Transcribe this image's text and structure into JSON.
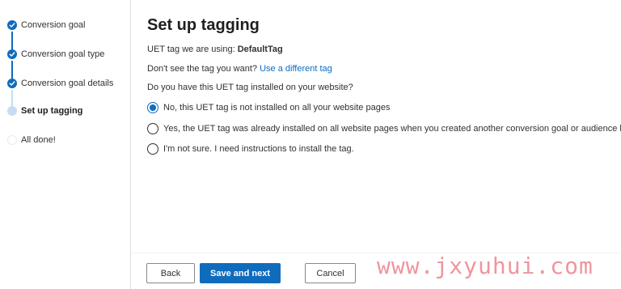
{
  "stepper": {
    "steps": [
      {
        "label": "Conversion goal",
        "state": "done"
      },
      {
        "label": "Conversion goal type",
        "state": "done"
      },
      {
        "label": "Conversion goal details",
        "state": "done"
      },
      {
        "label": "Set up tagging",
        "state": "current"
      },
      {
        "label": "All done!",
        "state": "todo"
      }
    ]
  },
  "main": {
    "title": "Set up tagging",
    "uet_prefix": "UET tag we are using: ",
    "uet_tag_name": "DefaultTag",
    "dont_see_text": "Don't see the tag you want? ",
    "different_tag_link": "Use a different tag",
    "question": "Do you have this UET tag installed on your website?",
    "options": [
      {
        "label": "No, this UET tag is not installed on all your website pages",
        "selected": true
      },
      {
        "label": "Yes, the UET tag was already installed on all website pages when you created another conversion goal or audience list",
        "selected": false
      },
      {
        "label": "I'm not sure. I need instructions to install the tag.",
        "selected": false
      }
    ]
  },
  "footer": {
    "back_label": "Back",
    "save_next_label": "Save and next",
    "cancel_label": "Cancel"
  },
  "watermark": "www.jxyuhui.com",
  "colors": {
    "accent": "#0f6cbd",
    "current_step": "#c7dcf2",
    "watermark": "#ec828c"
  }
}
